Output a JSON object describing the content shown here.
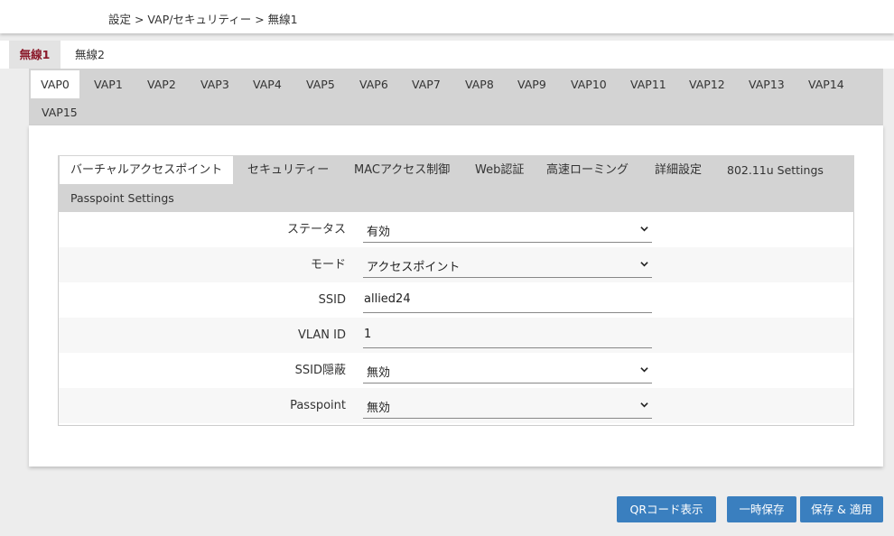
{
  "breadcrumb": "設定 > VAP/セキュリティー > 無線1",
  "wireless_tabs": [
    "無線1",
    "無線2"
  ],
  "vap_tabs": [
    "VAP0",
    "VAP1",
    "VAP2",
    "VAP3",
    "VAP4",
    "VAP5",
    "VAP6",
    "VAP7",
    "VAP8",
    "VAP9",
    "VAP10",
    "VAP11",
    "VAP12",
    "VAP13",
    "VAP14",
    "VAP15"
  ],
  "sub_tabs": [
    "バーチャルアクセスポイント",
    "セキュリティー",
    "MACアクセス制御",
    "Web認証",
    "高速ローミング",
    "詳細設定",
    "802.11u Settings",
    "Passpoint Settings"
  ],
  "form": {
    "status": {
      "label": "ステータス",
      "value": "有効"
    },
    "mode": {
      "label": "モード",
      "value": "アクセスポイント"
    },
    "ssid": {
      "label": "SSID",
      "value": "allied24"
    },
    "vlan_id": {
      "label": "VLAN ID",
      "value": "1"
    },
    "ssid_stealth": {
      "label": "SSID隠蔽",
      "value": "無効"
    },
    "passpoint": {
      "label": "Passpoint",
      "value": "無効"
    }
  },
  "buttons": {
    "qr": "QRコード表示",
    "temp_save": "一時保存",
    "save_apply": "保存 & 適用"
  },
  "colors": {
    "accent": "#3a7fbf",
    "active_wireless_tab_text": "#8b1a2b"
  }
}
